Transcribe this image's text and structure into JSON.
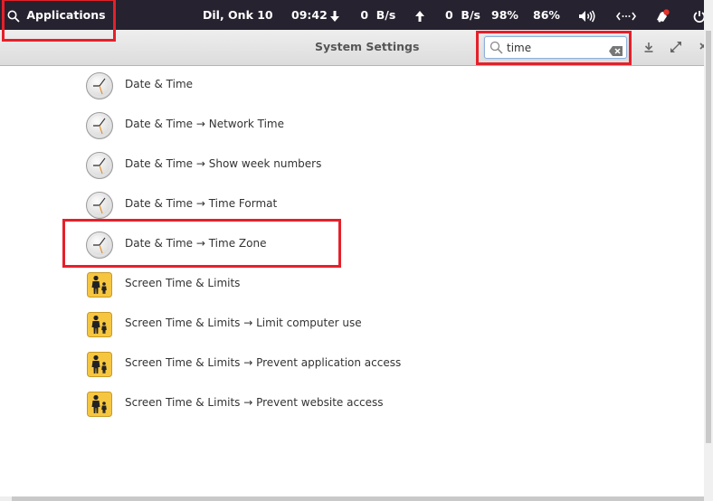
{
  "panel": {
    "applications_label": "Applications",
    "date": "Dil, Onk 10",
    "time": "09:42",
    "download_rate": "0  B/s",
    "upload_rate": "0  B/s",
    "battery_percent": "98%",
    "volume_percent": "86%",
    "icons": [
      "search-icon",
      "download-arrow-icon",
      "upload-arrow-icon",
      "volume-icon",
      "network-icon",
      "notification-bell-icon",
      "power-icon"
    ]
  },
  "window": {
    "title": "System Settings",
    "search": {
      "value": "time",
      "placeholder": ""
    },
    "buttons": [
      "download-icon",
      "maximize-icon",
      "close-icon"
    ]
  },
  "results": [
    {
      "label": "Date & Time",
      "icon": "clock-icon"
    },
    {
      "label": "Date & Time → Network Time",
      "icon": "clock-icon"
    },
    {
      "label": "Date & Time → Show week numbers",
      "icon": "clock-icon"
    },
    {
      "label": "Date & Time → Time Format",
      "icon": "clock-icon"
    },
    {
      "label": "Date & Time → Time Zone",
      "icon": "clock-icon"
    },
    {
      "label": "Screen Time & Limits",
      "icon": "parental-controls-icon"
    },
    {
      "label": "Screen Time & Limits → Limit computer use",
      "icon": "parental-controls-icon"
    },
    {
      "label": "Screen Time & Limits → Prevent application access",
      "icon": "parental-controls-icon"
    },
    {
      "label": "Screen Time & Limits → Prevent website access",
      "icon": "parental-controls-icon"
    }
  ],
  "colors": {
    "panel_bg": "#26222f",
    "highlight_red": "#e5202a",
    "search_focus": "#8fb1d9"
  }
}
